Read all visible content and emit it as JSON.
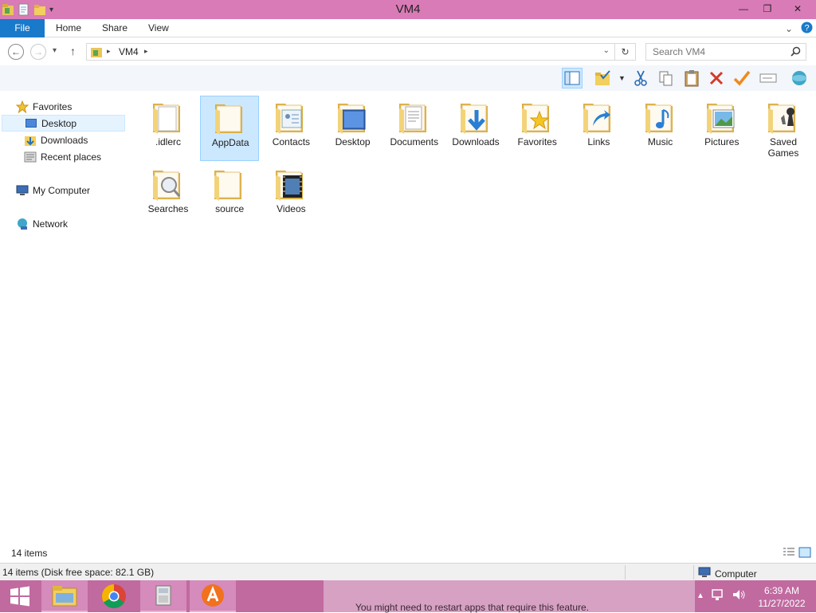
{
  "window": {
    "title": "VM4",
    "minimize": "—",
    "maximize": "❐",
    "close": "✕"
  },
  "ribbon": {
    "tabs": [
      "File",
      "Home",
      "Share",
      "View"
    ]
  },
  "address": {
    "crumb": "VM4",
    "search_placeholder": "Search VM4"
  },
  "nav": {
    "favorites": "Favorites",
    "desktop": "Desktop",
    "downloads": "Downloads",
    "recent": "Recent places",
    "computer": "My Computer",
    "network": "Network"
  },
  "items": [
    {
      "label": ".idlerc",
      "overlay": "doc"
    },
    {
      "label": "AppData",
      "overlay": "plain",
      "selected": true
    },
    {
      "label": "Contacts",
      "overlay": "contacts"
    },
    {
      "label": "Desktop",
      "overlay": "desktop"
    },
    {
      "label": "Documents",
      "overlay": "documents"
    },
    {
      "label": "Downloads",
      "overlay": "downloads"
    },
    {
      "label": "Favorites",
      "overlay": "star"
    },
    {
      "label": "Links",
      "overlay": "links"
    },
    {
      "label": "Music",
      "overlay": "music"
    },
    {
      "label": "Pictures",
      "overlay": "pictures"
    },
    {
      "label": "Saved Games",
      "overlay": "games"
    },
    {
      "label": "Searches",
      "overlay": "search"
    },
    {
      "label": "source",
      "overlay": "plain"
    },
    {
      "label": "Videos",
      "overlay": "videos"
    }
  ],
  "status": {
    "item_count": "14 items",
    "detail": "14 items (Disk free space: 82.1 GB)",
    "location": "Computer"
  },
  "taskbar": {
    "notice": "You might need to restart apps that require this feature.",
    "time": "6:39 AM",
    "date": "11/27/2022"
  },
  "colors": {
    "titlebar": "#d97bb6",
    "file_tab": "#1979ca",
    "taskbar": "#c06aa0",
    "selection": "#cce8ff"
  }
}
